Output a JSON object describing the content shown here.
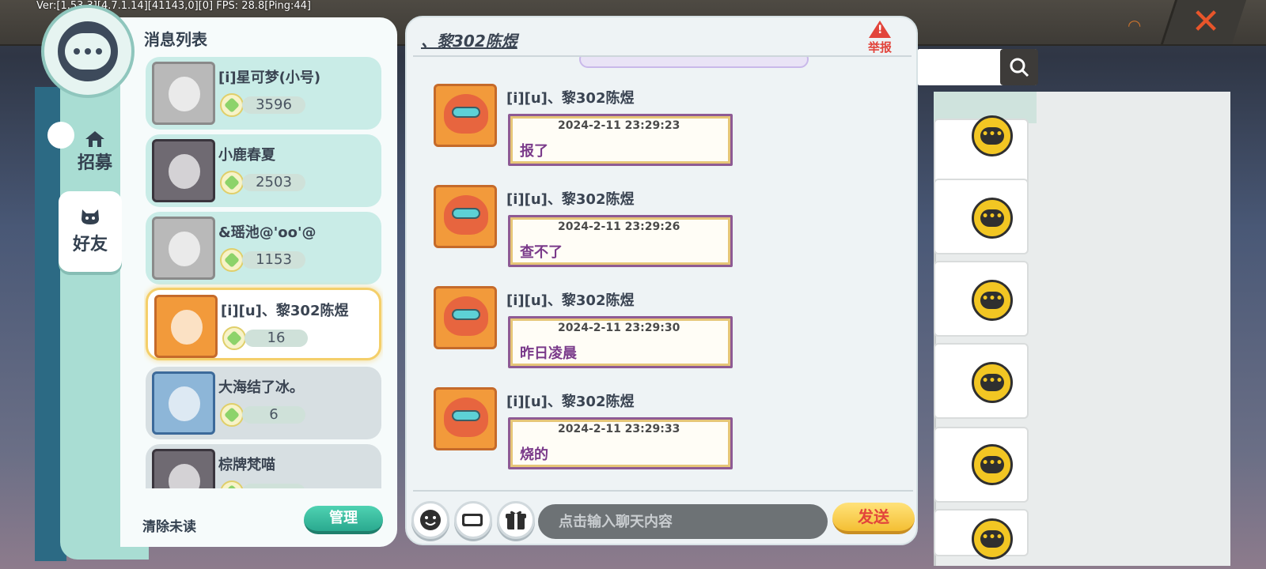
{
  "debug": {
    "text": "Ver:[1.53.3][4.7.1.14][41143,0][0] FPS: 28.8[Ping:44]"
  },
  "sidebar": {
    "tabs": [
      {
        "label": "招募"
      },
      {
        "label": "好友"
      }
    ]
  },
  "message_list": {
    "title": "消息列表",
    "items": [
      {
        "name": "[i]星可梦(小号)",
        "count": "3596"
      },
      {
        "name": "小鹿春夏",
        "count": "2503"
      },
      {
        "name": "&瑶池@'oo'@",
        "count": "1153"
      },
      {
        "name": "[i][u]、黎302陈煜",
        "count": "16"
      },
      {
        "name": "大海结了冰。",
        "count": "6"
      },
      {
        "name": "棕牌梵喵",
        "count": ""
      }
    ],
    "clear_unread_label": "清除未读",
    "manage_label": "管理"
  },
  "chat": {
    "title": "、黎302陈煜",
    "report_label": "举报",
    "messages": [
      {
        "sender": "[i][u]、黎302陈煜",
        "time": "2024-2-11      23:29:23",
        "text": "报了"
      },
      {
        "sender": "[i][u]、黎302陈煜",
        "time": "2024-2-11      23:29:26",
        "text": "查不了"
      },
      {
        "sender": "[i][u]、黎302陈煜",
        "time": "2024-2-11      23:29:30",
        "text": "昨日凌晨"
      },
      {
        "sender": "[i][u]、黎302陈煜",
        "time": "2024-2-11      23:29:33",
        "text": "烧的"
      }
    ],
    "input_placeholder": "点击输入聊天内容",
    "send_label": "发送"
  },
  "colors": {
    "accent_teal": "#2aa98f",
    "send_yellow": "#f4bf33",
    "report_red": "#e2443b"
  },
  "icons": [
    "chat-bubble-icon",
    "home-icon",
    "cat-icon",
    "emoji-icon",
    "card-icon",
    "gift-icon",
    "search-icon",
    "close-icon",
    "rss-icon",
    "warning-icon",
    "gem-icon"
  ]
}
